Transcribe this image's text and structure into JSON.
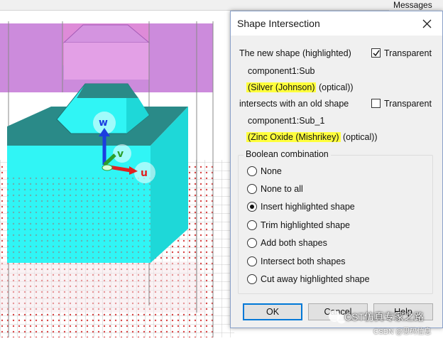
{
  "top_bar": {
    "messages_tab": "Messages"
  },
  "viewport": {
    "axis_labels": {
      "w": "w",
      "v": "v",
      "u": "u"
    },
    "colors": {
      "substrate": "#30f5f5",
      "substrate_top": "#2a8a88",
      "purple_region": "#c77ed8",
      "grid": "#c8c8c8",
      "dots": "#d23030",
      "axis_w": "#1b3ee0",
      "axis_v": "#2ca02c",
      "axis_u": "#e02020"
    }
  },
  "dialog": {
    "title": "Shape Intersection",
    "new_shape_label": "The new shape (highlighted)",
    "new_shape_transparent": {
      "label": "Transparent",
      "checked": true
    },
    "new_shape_name": "component1:Sub",
    "new_shape_material_highlight": "(Silver (Johnson)",
    "new_shape_material_rest": " (optical))",
    "intersects_label": "intersects with an old shape",
    "old_shape_transparent": {
      "label": "Transparent",
      "checked": false
    },
    "old_shape_name": "component1:Sub_1",
    "old_shape_material_highlight": "(Zinc Oxide (Mishrikey)",
    "old_shape_material_rest": " (optical))",
    "group_title": "Boolean combination",
    "options": [
      {
        "label": "None",
        "selected": false
      },
      {
        "label": "None to all",
        "selected": false
      },
      {
        "label": "Insert highlighted shape",
        "selected": true
      },
      {
        "label": "Trim highlighted shape",
        "selected": false
      },
      {
        "label": "Add both shapes",
        "selected": false
      },
      {
        "label": "Intersect both shapes",
        "selected": false
      },
      {
        "label": "Cut away highlighted shape",
        "selected": false
      }
    ],
    "buttons": {
      "ok": "OK",
      "cancel": "Cancel",
      "help": "Help"
    }
  },
  "watermark": {
    "line1": "CST仿真专家之路",
    "line2": "CSDN @思码信息"
  }
}
